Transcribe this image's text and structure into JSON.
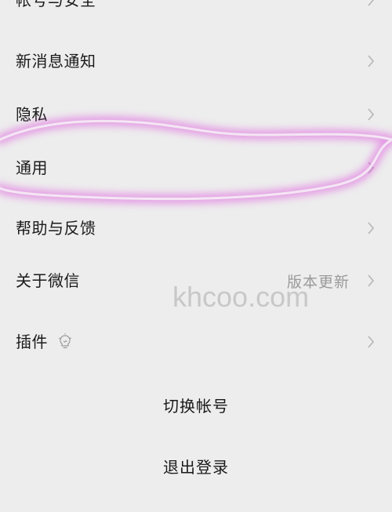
{
  "menu": {
    "account_security": "帐号与安全",
    "new_message_notify": "新消息通知",
    "privacy": "隐私",
    "general": "通用",
    "help_feedback": "帮助与反馈",
    "about_wechat": "关于微信",
    "about_value": "版本更新",
    "plugins": "插件"
  },
  "actions": {
    "switch_account": "切换帐号",
    "logout": "退出登录"
  },
  "watermark": "khcoo.com",
  "icons": {
    "chevron": "chevron-right-icon",
    "plugin_hint": "lightbulb-icon"
  },
  "colors": {
    "background": "#ededed",
    "highlight": "#e060e0"
  }
}
